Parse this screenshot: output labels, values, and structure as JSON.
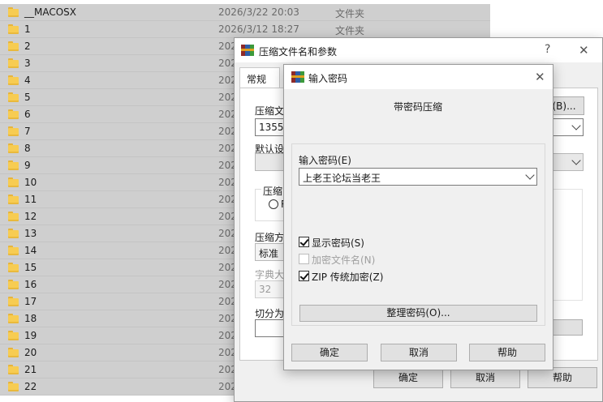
{
  "explorer": {
    "rows": [
      {
        "name": "__MACOSX",
        "date": "2026/3/22 20:03",
        "type": "文件夹"
      },
      {
        "name": "1",
        "date": "2026/3/12 18:27",
        "type": "文件夹"
      },
      {
        "name": "2",
        "date": "202",
        "type": ""
      },
      {
        "name": "3",
        "date": "202",
        "type": ""
      },
      {
        "name": "4",
        "date": "202",
        "type": ""
      },
      {
        "name": "5",
        "date": "202",
        "type": ""
      },
      {
        "name": "6",
        "date": "202",
        "type": ""
      },
      {
        "name": "7",
        "date": "202",
        "type": ""
      },
      {
        "name": "8",
        "date": "202",
        "type": ""
      },
      {
        "name": "9",
        "date": "202",
        "type": ""
      },
      {
        "name": "10",
        "date": "202",
        "type": ""
      },
      {
        "name": "11",
        "date": "202",
        "type": ""
      },
      {
        "name": "12",
        "date": "202",
        "type": ""
      },
      {
        "name": "13",
        "date": "202",
        "type": ""
      },
      {
        "name": "14",
        "date": "202",
        "type": ""
      },
      {
        "name": "15",
        "date": "202",
        "type": ""
      },
      {
        "name": "16",
        "date": "202",
        "type": ""
      },
      {
        "name": "17",
        "date": "202",
        "type": ""
      },
      {
        "name": "18",
        "date": "202",
        "type": ""
      },
      {
        "name": "19",
        "date": "202",
        "type": ""
      },
      {
        "name": "20",
        "date": "202",
        "type": ""
      },
      {
        "name": "21",
        "date": "202",
        "type": ""
      },
      {
        "name": "22",
        "date": "202",
        "type": ""
      }
    ]
  },
  "archive_dialog": {
    "title": "压缩文件名和参数",
    "help_glyph": "?",
    "close_glyph": "✕",
    "tab_general": "常规",
    "archive_name_label": "压缩文",
    "archive_name_value": "1355.z",
    "browse_button": "(B)...",
    "default_profile_label": "默认设",
    "format_group_label": "压缩",
    "format_radio_label": "R",
    "method_label": "压缩方",
    "method_value": "标准",
    "dict_label": "字典大",
    "dict_value": "32",
    "split_label": "切分为",
    "ok_button": "确定",
    "cancel_button": "取消",
    "help_button": "帮助"
  },
  "password_dialog": {
    "title": "输入密码",
    "close_glyph": "✕",
    "heading": "带密码压缩",
    "password_label": "输入密码(E)",
    "password_value": "上老王论坛当老王",
    "show_password": {
      "label": "显示密码(S)",
      "checked": true
    },
    "encrypt_names": {
      "label": "加密文件名(N)",
      "checked": false,
      "disabled": true
    },
    "zip_legacy": {
      "label": "ZIP 传统加密(Z)",
      "checked": true
    },
    "organize_button": "整理密码(O)...",
    "ok_button": "确定",
    "cancel_button": "取消",
    "help_button": "帮助"
  }
}
